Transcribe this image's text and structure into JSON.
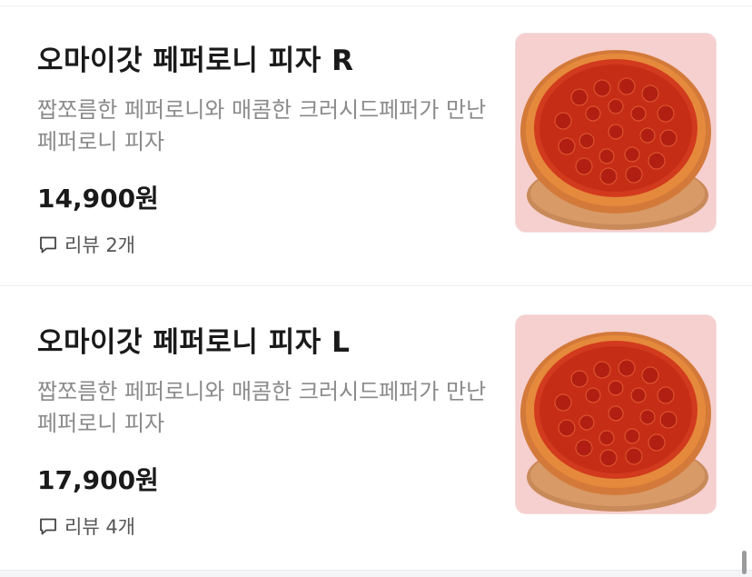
{
  "items": [
    {
      "name": "오마이갓 페퍼로니 피자 R",
      "description": "짭쪼름한 페퍼로니와 매콤한 크러시드페퍼가 만난 페퍼로니 피자",
      "price": "14,900원",
      "reviews": "리뷰 2개",
      "image_icon": "pizza-image"
    },
    {
      "name": "오마이갓 페퍼로니 피자 L",
      "description": "짭쪼름한 페퍼로니와 매콤한 크러시드페퍼가 만난 페퍼로니 피자",
      "price": "17,900원",
      "reviews": "리뷰 4개",
      "image_icon": "pizza-image"
    }
  ],
  "colors": {
    "name_text": "#1a1a1a",
    "description_text": "#8a8a8a",
    "thumbnail_background": "#f6cfcf",
    "divider": "#eeeeee"
  },
  "icons": {
    "review": "speech-bubble-icon"
  }
}
